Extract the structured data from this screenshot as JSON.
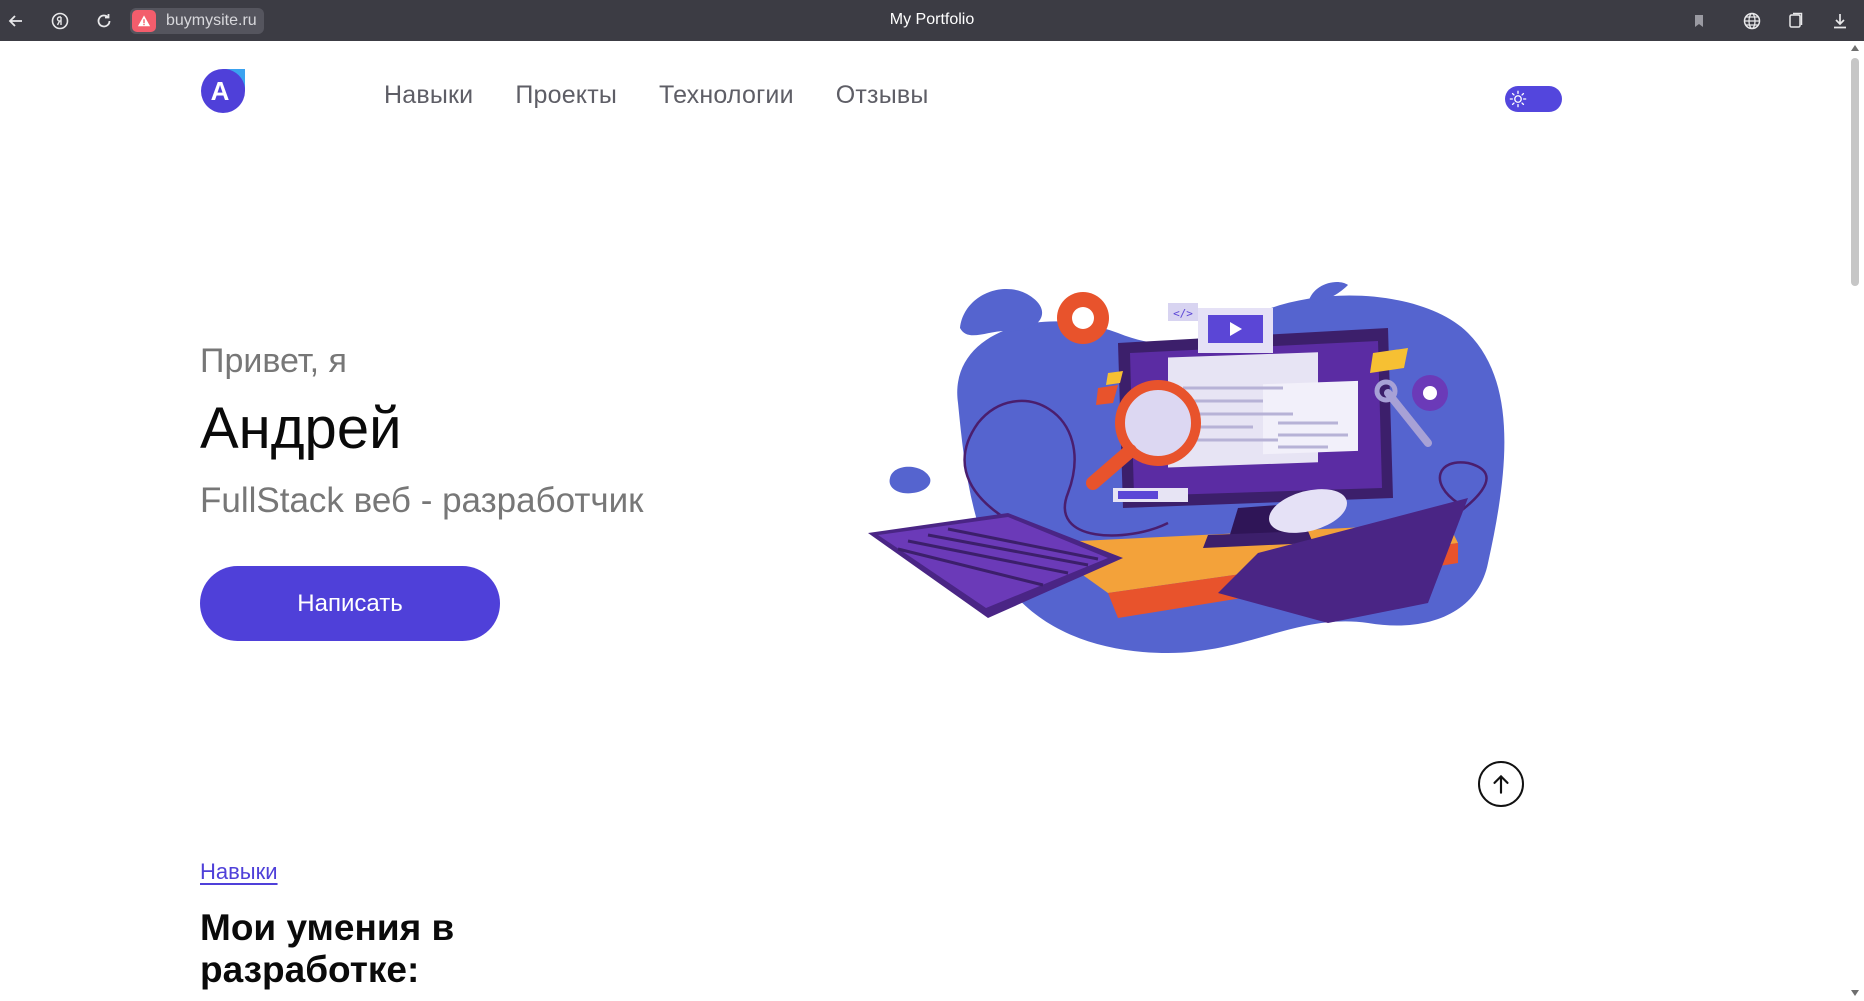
{
  "browser": {
    "url": "buymysite.ru",
    "tab_title": "My Portfolio"
  },
  "header": {
    "logo_letter": "A",
    "nav": [
      {
        "label": "Навыки"
      },
      {
        "label": "Проекты"
      },
      {
        "label": "Технологии"
      },
      {
        "label": "Отзывы"
      }
    ],
    "theme_toggle_icon": "sun-icon"
  },
  "hero": {
    "greeting": "Привет, я",
    "name": "Андрей",
    "role": "FullStack веб - разработчик",
    "cta_label": "Написать",
    "illustration": "computer-workspace-illustration"
  },
  "skills": {
    "tag": "Навыки",
    "title": "Мои умения в разработке:"
  },
  "colors": {
    "accent": "#4f40d9",
    "blob": "#5460d0",
    "chrome": "#3c3c44"
  }
}
